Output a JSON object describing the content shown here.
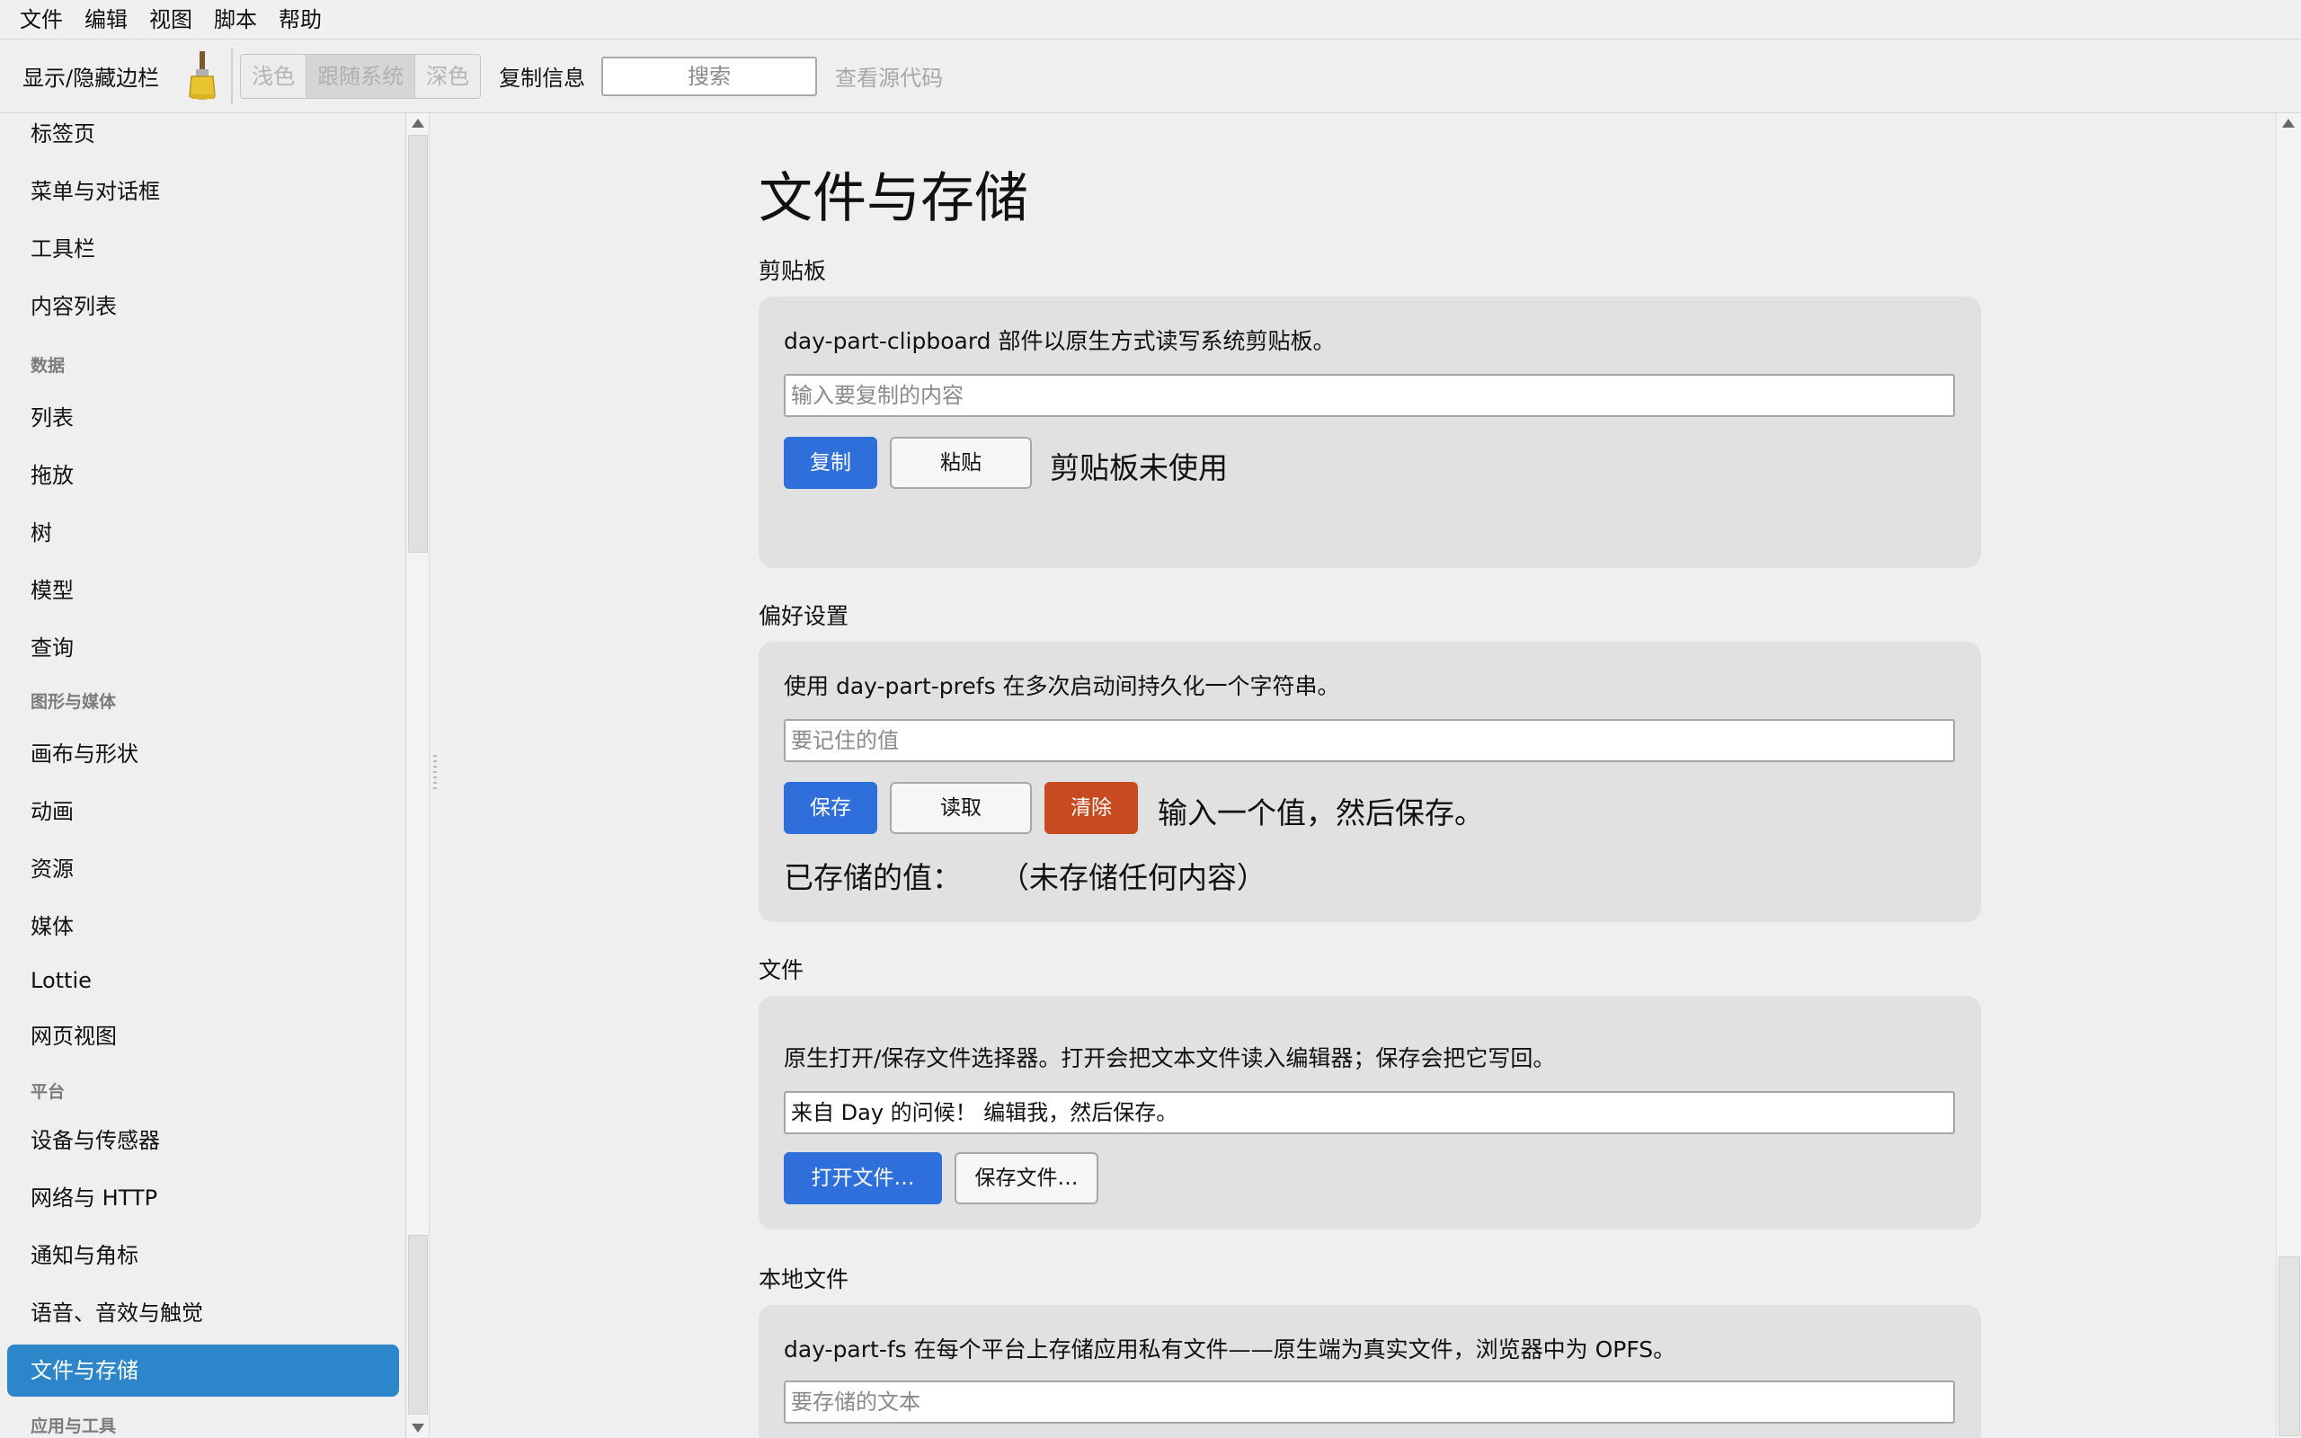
{
  "menubar": [
    "文件",
    "编辑",
    "视图",
    "脚本",
    "帮助"
  ],
  "toolbar": {
    "toggle_sidebar": "显示/隐藏边栏",
    "brush_icon": "brush-icon",
    "theme": [
      "浅色",
      "跟随系统",
      "深色"
    ],
    "theme_selected": "跟随系统",
    "copy_info": "复制信息",
    "search_placeholder": "搜索",
    "view_source": "查看源代码"
  },
  "sidebar": {
    "items": [
      {
        "type": "item",
        "label": "标签页"
      },
      {
        "type": "item",
        "label": "菜单与对话框"
      },
      {
        "type": "item",
        "label": "工具栏"
      },
      {
        "type": "item",
        "label": "内容列表"
      },
      {
        "type": "section",
        "label": "数据"
      },
      {
        "type": "item",
        "label": "列表"
      },
      {
        "type": "item",
        "label": "拖放"
      },
      {
        "type": "item",
        "label": "树"
      },
      {
        "type": "item",
        "label": "模型"
      },
      {
        "type": "item",
        "label": "查询"
      },
      {
        "type": "section",
        "label": "图形与媒体"
      },
      {
        "type": "item",
        "label": "画布与形状"
      },
      {
        "type": "item",
        "label": "动画"
      },
      {
        "type": "item",
        "label": "资源"
      },
      {
        "type": "item",
        "label": "媒体"
      },
      {
        "type": "item",
        "label": "Lottie"
      },
      {
        "type": "item",
        "label": "网页视图"
      },
      {
        "type": "section",
        "label": "平台"
      },
      {
        "type": "item",
        "label": "设备与传感器"
      },
      {
        "type": "item",
        "label": "网络与 HTTP"
      },
      {
        "type": "item",
        "label": "通知与角标"
      },
      {
        "type": "item",
        "label": "语音、音效与触觉"
      },
      {
        "type": "item",
        "label": "文件与存储",
        "active": true
      },
      {
        "type": "section",
        "label": "应用与工具"
      }
    ]
  },
  "main": {
    "title": "文件与存储",
    "clipboard": {
      "heading": "剪贴板",
      "description": "day-part-clipboard 部件以原生方式读写系统剪贴板。",
      "input_placeholder": "输入要复制的内容",
      "copy_button": "复制",
      "paste_button": "粘贴",
      "status": "剪贴板未使用"
    },
    "prefs": {
      "heading": "偏好设置",
      "description": "使用 day-part-prefs 在多次启动间持久化一个字符串。",
      "input_placeholder": "要记住的值",
      "save_button": "保存",
      "load_button": "读取",
      "clear_button": "清除",
      "status": "输入一个值，然后保存。",
      "stored_label": "已存储的值：",
      "stored_value": "（未存储任何内容）"
    },
    "file": {
      "heading": "文件",
      "description": "原生打开/保存文件选择器。打开会把文本文件读入编辑器；保存会把它写回。",
      "editor_value": "来自 Day 的问候！ 编辑我，然后保存。",
      "open_button": "打开文件…",
      "save_button": "保存文件…"
    },
    "local_files": {
      "heading": "本地文件",
      "description": "day-part-fs 在每个平台上存储应用私有文件——原生端为真实文件，浏览器中为 OPFS。",
      "input_placeholder": "要存储的文本"
    }
  }
}
